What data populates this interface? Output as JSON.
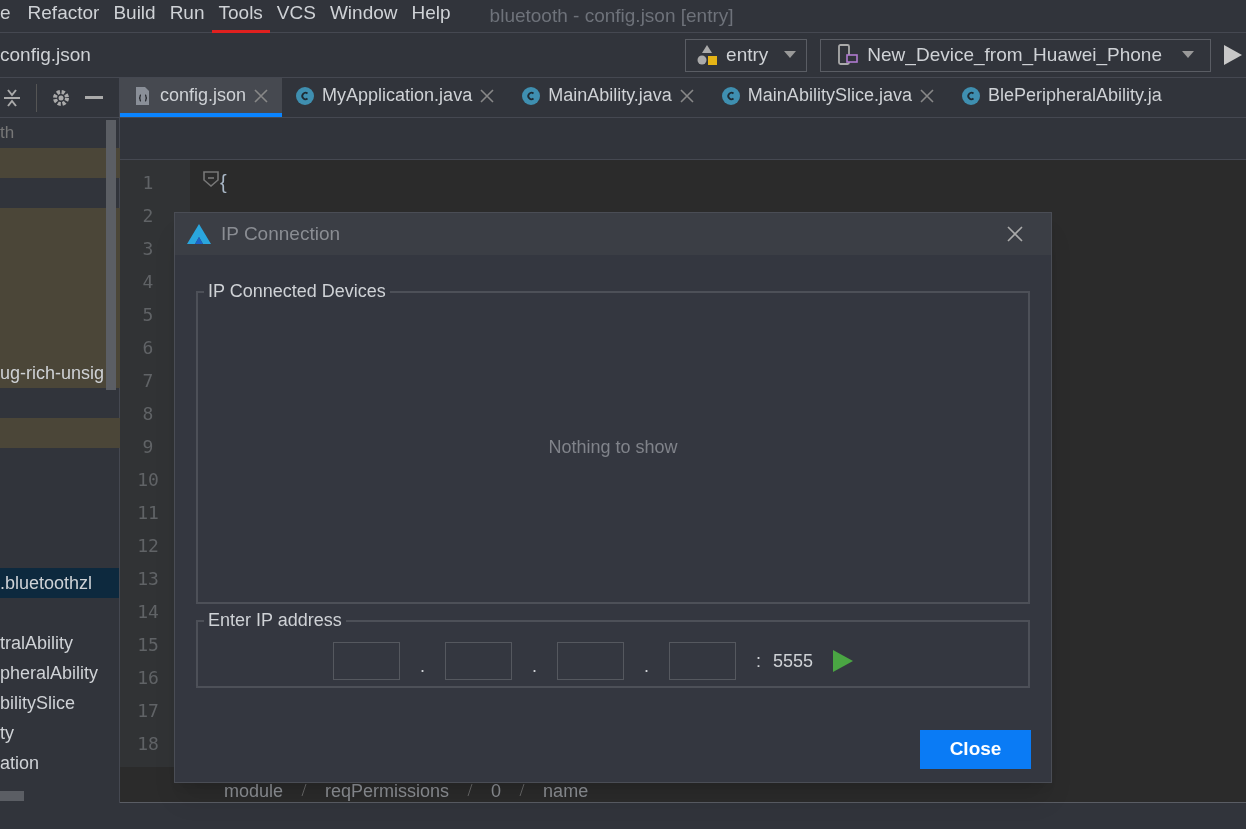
{
  "menu_bar": {
    "items": [
      {
        "label": "e",
        "marked": false
      },
      {
        "label": "Refactor",
        "marked": false
      },
      {
        "label": "Build",
        "marked": false
      },
      {
        "label": "Run",
        "marked": false
      },
      {
        "label": "Tools",
        "marked": true
      },
      {
        "label": "VCS",
        "marked": false
      },
      {
        "label": "Window",
        "marked": false
      },
      {
        "label": "Help",
        "marked": false
      }
    ],
    "title": "bluetooth - config.json [entry]"
  },
  "nav_bar": {
    "path": "config.json",
    "module_selector": "entry",
    "device_selector": "New_Device_from_Huawei_Phone"
  },
  "project_tree": {
    "header": "th",
    "rows": [
      {
        "text": "ug-rich-unsig",
        "selected": false
      },
      {
        "text": ".bluetoothzl",
        "selected": true
      },
      {
        "text": "tralAbility",
        "selected": false
      },
      {
        "text": "pheralAbility",
        "selected": false
      },
      {
        "text": "bilitySlice",
        "selected": false
      },
      {
        "text": "ty",
        "selected": false
      },
      {
        "text": "ation",
        "selected": false
      }
    ]
  },
  "tabs": [
    {
      "label": "config.json",
      "kind": "json",
      "selected": true
    },
    {
      "label": "MyApplication.java",
      "kind": "class",
      "selected": false
    },
    {
      "label": "MainAbility.java",
      "kind": "class",
      "selected": false
    },
    {
      "label": "MainAbilitySlice.java",
      "kind": "class",
      "selected": false
    },
    {
      "label": "BlePeripheralAbility.ja",
      "kind": "class",
      "selected": false
    }
  ],
  "editor": {
    "line_numbers": [
      "1",
      "2",
      "3",
      "4",
      "5",
      "6",
      "7",
      "8",
      "9",
      "10",
      "11",
      "12",
      "13",
      "14",
      "15",
      "16",
      "17",
      "18"
    ],
    "first_line": "{",
    "breadcrumb": [
      "module",
      "reqPermissions",
      "0",
      "name"
    ]
  },
  "dialog": {
    "title": "IP Connection",
    "devices_group": {
      "title": "IP Connected Devices",
      "empty_text": "Nothing to show"
    },
    "address_group": {
      "title": "Enter IP address",
      "separators": [
        ".",
        ".",
        "."
      ],
      "colon": ":",
      "port": "5555"
    },
    "close_button": "Close"
  }
}
